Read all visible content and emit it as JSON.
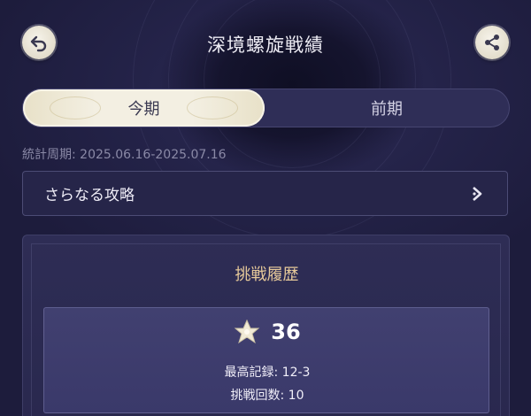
{
  "header": {
    "title": "深境螺旋戦績",
    "back_icon": "back-arrow-icon",
    "share_icon": "share-icon"
  },
  "tabs": [
    {
      "label": "今期",
      "active": true
    },
    {
      "label": "前期",
      "active": false
    }
  ],
  "period": {
    "text": "統計周期: 2025.06.16-2025.07.16"
  },
  "strategy": {
    "label": "さらなる攻略",
    "icon": "chevron-right-icon"
  },
  "history": {
    "title": "挑戦履歴",
    "star_icon": "star-icon",
    "stars": "36",
    "best_record": "最高記録: 12-3",
    "attempts": "挑戦回数: 10"
  },
  "colors": {
    "background": "#1d1c3c",
    "accent_gold": "#e6c99a",
    "tab_active": "#f3efe2"
  }
}
